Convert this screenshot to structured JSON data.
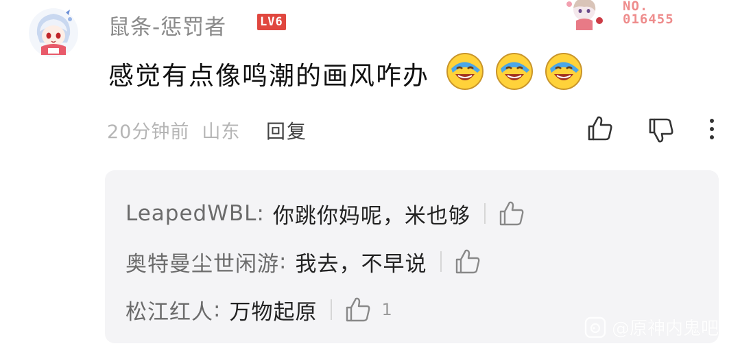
{
  "comment": {
    "username": "鼠条-惩罚者",
    "level_badge": "LV6",
    "pendant": {
      "label": "NO.",
      "number": "016455"
    },
    "text": "感觉有点像鸣潮的画风咋办",
    "emojis": [
      "laughing-cry-emoji",
      "laughing-cry-emoji",
      "laughing-cry-emoji"
    ],
    "time": "20分钟前",
    "location": "山东",
    "reply_label": "回复",
    "icons": {
      "like": "thumbs-up-icon",
      "dislike": "thumbs-down-icon",
      "more": "more-vertical-icon"
    }
  },
  "replies": [
    {
      "author": "LeapedWBL",
      "text": "你跳你妈呢，米也够",
      "likes": ""
    },
    {
      "author": "奥特曼尘世闲游",
      "text": "我去，不早说",
      "likes": ""
    },
    {
      "author": "松江红人",
      "text": "万物起原",
      "likes": "1"
    }
  ],
  "watermark": {
    "text": "@原神内鬼吧"
  },
  "colors": {
    "badge": "#e0473f",
    "pendant_text": "#ee8c8c",
    "meta_text": "#b5b5b5",
    "reply_bg": "#f4f4f6"
  }
}
